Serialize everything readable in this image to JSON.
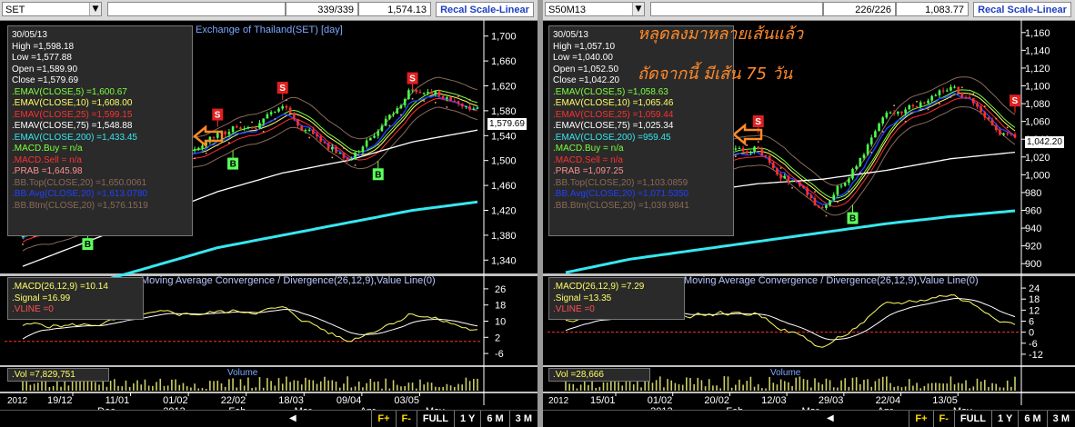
{
  "windows": [
    {
      "symbol": "SET",
      "bars": "339/339",
      "last": "1,574.13",
      "scale_button": "Recal Scale-Linear",
      "title": "Exchange of Thailand(SET) [day]",
      "last_tag": "1,579.69",
      "legend": [
        {
          "text": "30/05/13",
          "color": "#ffffff"
        },
        {
          "text": "High   =1,598.18",
          "color": "#ffffff"
        },
        {
          "text": "Low    =1,577.88",
          "color": "#ffffff"
        },
        {
          "text": "Open   =1,589.90",
          "color": "#ffffff"
        },
        {
          "text": "Close  =1,579.69",
          "color": "#ffffff"
        },
        {
          "text": ".EMAV(CLOSE,5)    =1,600.67",
          "color": "#7cff3c"
        },
        {
          "text": ".EMAV(CLOSE,10)   =1,608.00",
          "color": "#ffff66"
        },
        {
          "text": ".EMAV(CLOSE,25)   =1,599.15",
          "color": "#ff3030"
        },
        {
          "text": ".EMAV(CLOSE,75)   =1,548.88",
          "color": "#ffffff"
        },
        {
          "text": ".EMAV(CLOSE,200)  =1,433.45",
          "color": "#37e7f0"
        },
        {
          "text": ".MACD.Buy    = n/a",
          "color": "#7cff3c"
        },
        {
          "text": ".MACD.Sell   = n/a",
          "color": "#ff3030"
        },
        {
          "text": ".PRAB   =1,645.98",
          "color": "#ff9090"
        },
        {
          "text": ".BB.Top(CLOSE,20)   =1,650.0061",
          "color": "#8a6a5a"
        },
        {
          "text": ".BB.Avg(CLOSE,20)   =1,613.0780",
          "color": "#2040ff"
        },
        {
          "text": ".BB.Btm(CLOSE,20)   =1,576.1519",
          "color": "#8a6a5a"
        }
      ],
      "macd_title": "Moving Average Convergence / Divergence(26,12,9),Value Line(0)",
      "macd_legend": [
        {
          "text": ".MACD(26,12,9)   =10.14",
          "color": "#ffff66"
        },
        {
          "text": ".Signal   =16.99",
          "color": "#ffff66"
        },
        {
          "text": ".VLINE    =0",
          "color": "#ff5050"
        }
      ],
      "vol_legend": ".Vol   =7,829,751",
      "vol_title": "Volume",
      "price_ticks": [
        "1,700",
        "1,660",
        "1,620",
        "1,580",
        "1,540",
        "1,500",
        "1,460",
        "1,420",
        "1,380",
        "1,340"
      ],
      "macd_ticks": [
        "26",
        "18",
        "10",
        "2",
        "-6"
      ],
      "date_top": [
        "19/12",
        "11/01",
        "01/02",
        "22/02",
        "18/03",
        "09/04",
        "03/05"
      ],
      "date_bottom": [
        "2012",
        "Dec",
        "2013",
        "Feb",
        "Mar",
        "Apr",
        "May"
      ]
    },
    {
      "symbol": "S50M13",
      "bars": "226/226",
      "last": "1,083.77",
      "scale_button": "Recal Scale-Linear",
      "title": "",
      "last_tag": "1,042.20",
      "annotation_line1": "หลุดลงมาหลายเส้นแล้ว",
      "annotation_line2": "ถัดจากนี้ มีเส้น 75 วัน",
      "legend": [
        {
          "text": "30/05/13",
          "color": "#ffffff"
        },
        {
          "text": "High   =1,057.10",
          "color": "#ffffff"
        },
        {
          "text": "Low    =1,040.00",
          "color": "#ffffff"
        },
        {
          "text": "Open   =1,052.50",
          "color": "#ffffff"
        },
        {
          "text": "Close  =1,042.20",
          "color": "#ffffff"
        },
        {
          "text": ".EMAV(CLOSE,5)    =1,058.63",
          "color": "#7cff3c"
        },
        {
          "text": ".EMAV(CLOSE,10)   =1,065.46",
          "color": "#ffff66"
        },
        {
          "text": ".EMAV(CLOSE,25)   =1,059.44",
          "color": "#ff3030"
        },
        {
          "text": ".EMAV(CLOSE,75)   =1,025.34",
          "color": "#ffffff"
        },
        {
          "text": ".EMAV(CLOSE,200)  =959.45",
          "color": "#37e7f0"
        },
        {
          "text": ".MACD.Buy    = n/a",
          "color": "#7cff3c"
        },
        {
          "text": ".MACD.Sell   = n/a",
          "color": "#ff3030"
        },
        {
          "text": ".PRAB   =1,097.25",
          "color": "#ff9090"
        },
        {
          "text": ".BB.Top(CLOSE,20)   =1,103.0859",
          "color": "#8a6a5a"
        },
        {
          "text": ".BB.Avg(CLOSE,20)   =1,071.5350",
          "color": "#2040ff"
        },
        {
          "text": ".BB.Btm(CLOSE,20)   =1,039.9841",
          "color": "#8a6a5a"
        }
      ],
      "macd_title": "Moving Average Convergence / Divergence(26,12,9),Value Line(0)",
      "macd_legend": [
        {
          "text": ".MACD(26,12,9)   =7.29",
          "color": "#ffff66"
        },
        {
          "text": ".Signal   =13.35",
          "color": "#ffff66"
        },
        {
          "text": ".VLINE    =0",
          "color": "#ff5050"
        }
      ],
      "vol_legend": ".Vol   =28,666",
      "vol_title": "Volume",
      "price_ticks": [
        "1,160",
        "1,140",
        "1,120",
        "1,100",
        "1,080",
        "1,060",
        "1,040",
        "1,020",
        "1,000",
        "980",
        "960",
        "940",
        "920",
        "900"
      ],
      "macd_ticks": [
        "24",
        "18",
        "12",
        "6",
        "0",
        "-6",
        "-12"
      ],
      "date_top": [
        "15/01",
        "01/02",
        "20/02",
        "12/03",
        "29/03",
        "22/04",
        "13/05"
      ],
      "date_bottom": [
        "2012",
        "2013",
        "Feb",
        "Mar",
        "Apr",
        "May"
      ]
    }
  ],
  "nav": {
    "f_plus": "F+",
    "f_minus": "F-",
    "full": "FULL",
    "y1": "1 Y",
    "m6": "6 M",
    "m3": "3 M"
  },
  "chart_data": [
    {
      "type": "line",
      "title": "Exchange of Thailand(SET) [day]",
      "xlabel": "",
      "ylabel": "",
      "ylim": [
        1320,
        1720
      ],
      "x": [
        "19/12",
        "11/01",
        "01/02",
        "22/02",
        "18/03",
        "09/04",
        "03/05",
        "30/05"
      ],
      "series": [
        {
          "name": "Close",
          "values": [
            1380,
            1420,
            1490,
            1540,
            1580,
            1500,
            1620,
            1579.69
          ]
        },
        {
          "name": ".EMAV(CLOSE,75)",
          "values": [
            1330,
            1370,
            1410,
            1450,
            1480,
            1500,
            1530,
            1548.88
          ]
        },
        {
          "name": ".EMAV(CLOSE,200)",
          "values": [
            1280,
            1300,
            1330,
            1360,
            1380,
            1400,
            1420,
            1433.45
          ]
        }
      ],
      "signals": {
        "sell": [
          "22/02",
          "18/03",
          "03/05"
        ],
        "buy": [
          "11/01",
          "22/02",
          "09/04"
        ]
      },
      "legend_position": "top-left",
      "grid": false
    },
    {
      "type": "line",
      "title": "",
      "xlabel": "",
      "ylabel": "",
      "ylim": [
        890,
        1170
      ],
      "x": [
        "15/01",
        "01/02",
        "20/02",
        "12/03",
        "29/03",
        "22/04",
        "13/05",
        "30/05"
      ],
      "series": [
        {
          "name": "Close",
          "values": [
            980,
            1010,
            1020,
            1030,
            960,
            1060,
            1100,
            1042.2
          ]
        },
        {
          "name": ".EMAV(CLOSE,75)",
          "values": [
            950,
            965,
            980,
            990,
            995,
            1005,
            1018,
            1025.34
          ]
        },
        {
          "name": ".EMAV(CLOSE,200)",
          "values": [
            890,
            905,
            915,
            925,
            935,
            945,
            953,
            959.45
          ]
        }
      ],
      "signals": {
        "sell": [
          "12/03",
          "30/05"
        ],
        "buy": [
          "01/02",
          "01/02",
          "29/03"
        ]
      },
      "legend_position": "top-left",
      "grid": false
    }
  ]
}
